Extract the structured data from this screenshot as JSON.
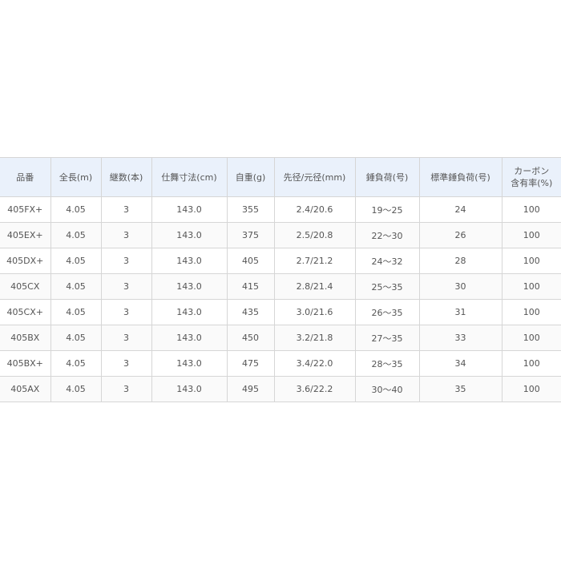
{
  "colors": {
    "header_bg": "#eaf1fb",
    "border": "#d6d6d6",
    "text": "#555555"
  },
  "table": {
    "headers": [
      "品番",
      "全長(m)",
      "継数(本)",
      "仕舞寸法(cm)",
      "自重(g)",
      "先径/元径(mm)",
      "錘負荷(号)",
      "標準錘負荷(号)",
      "カーボン\n含有率(%)"
    ],
    "rows": [
      [
        "405FX+",
        "4.05",
        "3",
        "143.0",
        "355",
        "2.4/20.6",
        "19〜25",
        "24",
        "100"
      ],
      [
        "405EX+",
        "4.05",
        "3",
        "143.0",
        "375",
        "2.5/20.8",
        "22〜30",
        "26",
        "100"
      ],
      [
        "405DX+",
        "4.05",
        "3",
        "143.0",
        "405",
        "2.7/21.2",
        "24〜32",
        "28",
        "100"
      ],
      [
        "405CX",
        "4.05",
        "3",
        "143.0",
        "415",
        "2.8/21.4",
        "25〜35",
        "30",
        "100"
      ],
      [
        "405CX+",
        "4.05",
        "3",
        "143.0",
        "435",
        "3.0/21.6",
        "26〜35",
        "31",
        "100"
      ],
      [
        "405BX",
        "4.05",
        "3",
        "143.0",
        "450",
        "3.2/21.8",
        "27〜35",
        "33",
        "100"
      ],
      [
        "405BX+",
        "4.05",
        "3",
        "143.0",
        "475",
        "3.4/22.0",
        "28〜35",
        "34",
        "100"
      ],
      [
        "405AX",
        "4.05",
        "3",
        "143.0",
        "495",
        "3.6/22.2",
        "30〜40",
        "35",
        "100"
      ]
    ]
  }
}
